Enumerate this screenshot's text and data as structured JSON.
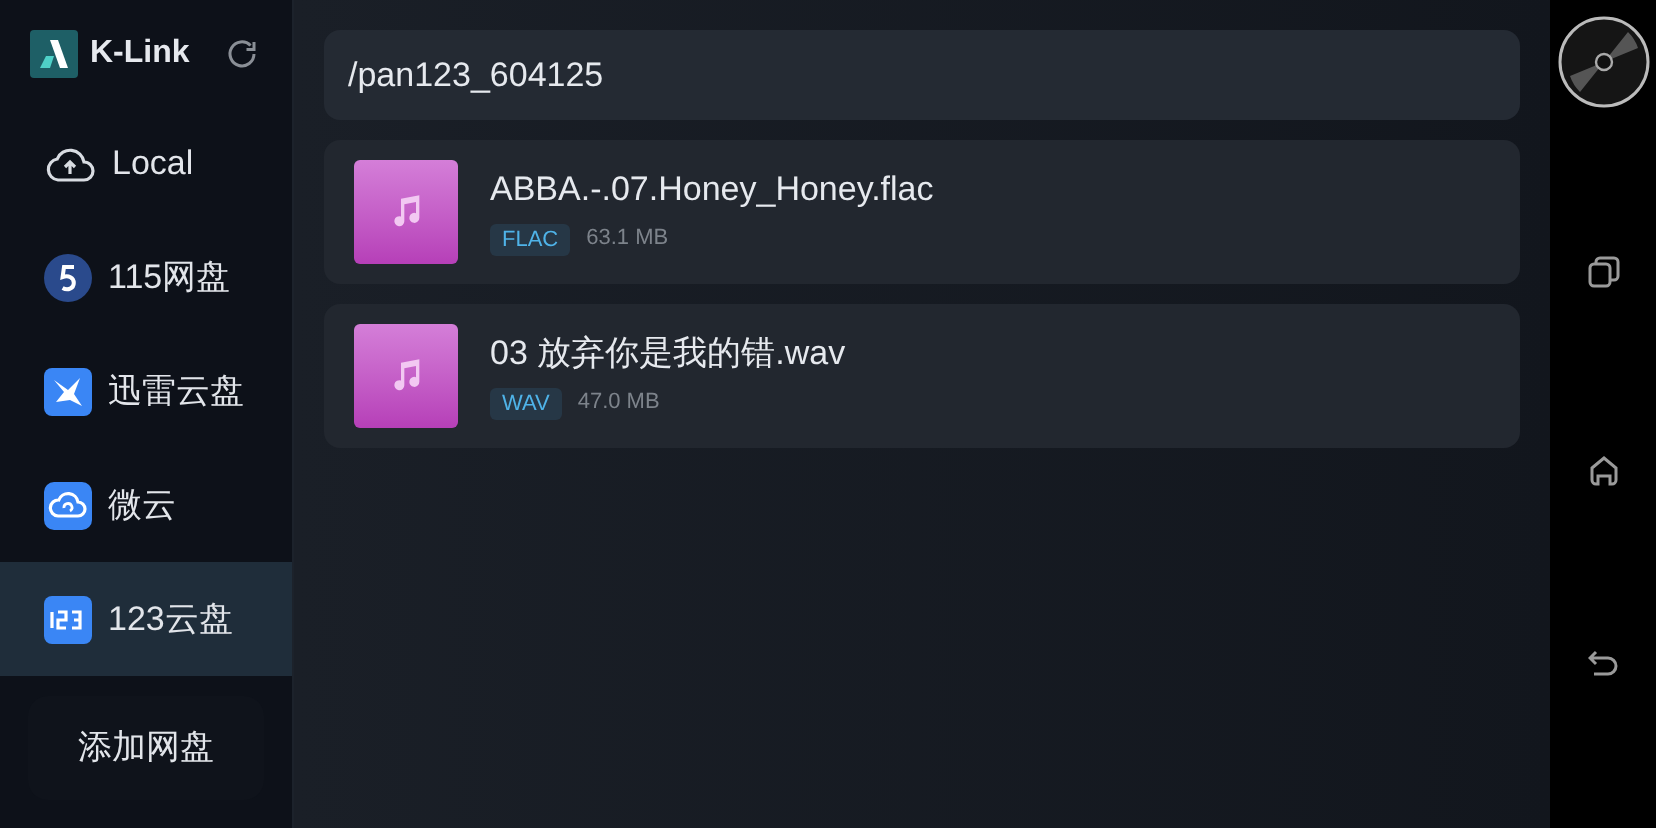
{
  "app": {
    "title": "K-Link"
  },
  "sidebar": {
    "items": [
      {
        "label": "Local",
        "kind": "local",
        "selected": false
      },
      {
        "label": "115网盘",
        "kind": "five",
        "selected": false
      },
      {
        "label": "迅雷云盘",
        "kind": "xunlei",
        "selected": false
      },
      {
        "label": "微云",
        "kind": "weiyun",
        "selected": false
      },
      {
        "label": "123云盘",
        "kind": "numbers",
        "selected": true
      }
    ],
    "add_button": "添加网盘"
  },
  "path": "/pan123_604125",
  "files": [
    {
      "name": "ABBA.-.07.Honey_Honey.flac",
      "format": "FLAC",
      "size": "63.1 MB"
    },
    {
      "name": "03 放弃你是我的错.wav",
      "format": "WAV",
      "size": "47.0 MB"
    }
  ]
}
